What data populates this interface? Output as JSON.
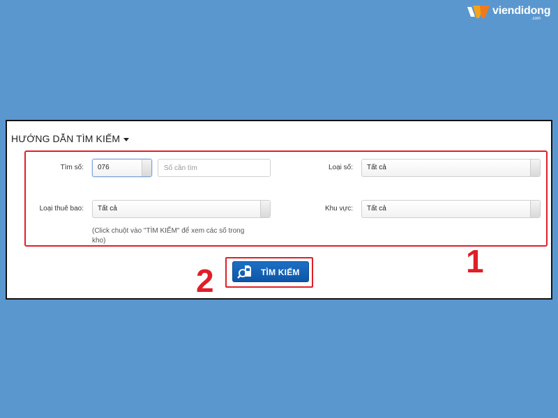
{
  "brand": {
    "name": "viendidong",
    "sub": ".com"
  },
  "panel": {
    "title": "HƯỚNG DẪN TÌM KIẾM"
  },
  "form": {
    "tim_so": {
      "label": "Tìm số:",
      "prefix_value": "076",
      "number_placeholder": "Số cần tìm"
    },
    "loai_so": {
      "label": "Loại số:",
      "selected": "Tất cả"
    },
    "loai_thue_bao": {
      "label": "Loại thuê bao:",
      "selected": "Tất cả"
    },
    "khu_vuc": {
      "label": "Khu vực:",
      "selected": "Tất cả"
    },
    "hint": "(Click chuột vào \"TÌM KIẾM\" để xem các số trong kho)"
  },
  "search_button": {
    "label": "TÌM KIẾM"
  },
  "annotations": {
    "step1": "1",
    "step2": "2",
    "highlight_color": "#e01e28"
  },
  "colors": {
    "background": "#5b97cf",
    "button": "#1565b8"
  }
}
